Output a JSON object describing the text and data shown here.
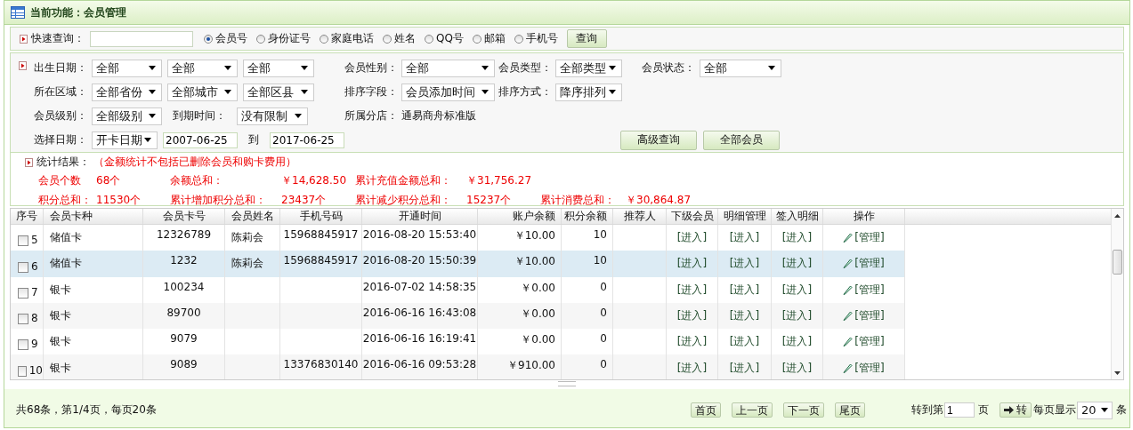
{
  "title": "当前功能：会员管理",
  "quick_search": {
    "label": "快速查询：",
    "options": [
      {
        "label": "会员号",
        "selected": true
      },
      {
        "label": "身份证号",
        "selected": false
      },
      {
        "label": "家庭电话",
        "selected": false
      },
      {
        "label": "姓名",
        "selected": false
      },
      {
        "label": "QQ号",
        "selected": false
      },
      {
        "label": "邮箱",
        "selected": false
      },
      {
        "label": "手机号",
        "selected": false
      }
    ],
    "button": "查询"
  },
  "filters": [
    [
      {
        "label": "出生日期：",
        "controls": [
          {
            "kind": "select",
            "value": "全部"
          },
          {
            "kind": "select",
            "value": "全部"
          },
          {
            "kind": "select",
            "value": "全部"
          }
        ]
      },
      {
        "label": "会员性别：",
        "controls": [
          {
            "kind": "select",
            "value": "全部"
          }
        ]
      },
      {
        "label": "会员类型：",
        "controls": [
          {
            "kind": "select",
            "value": "全部类型"
          }
        ]
      },
      {
        "label": "会员状态：",
        "controls": [
          {
            "kind": "select",
            "value": "全部"
          }
        ]
      }
    ],
    [
      {
        "label": "所在区域：",
        "controls": [
          {
            "kind": "select",
            "value": "全部省份"
          },
          {
            "kind": "select",
            "value": "全部城市"
          },
          {
            "kind": "select",
            "value": "全部区县"
          }
        ]
      },
      {
        "label": "排序字段：",
        "controls": [
          {
            "kind": "select",
            "value": "会员添加时间"
          }
        ]
      },
      {
        "label": "排序方式：",
        "controls": [
          {
            "kind": "select",
            "value": "降序排列"
          }
        ]
      }
    ],
    [
      {
        "label": "会员级别：",
        "controls": [
          {
            "kind": "select",
            "value": "全部级别"
          },
          {
            "kind": "label",
            "value": "到期时间："
          },
          {
            "kind": "select",
            "value": "没有限制"
          }
        ]
      },
      {
        "label": "所属分店：",
        "controls": [
          {
            "kind": "text",
            "value": "通易商舟标准版"
          }
        ]
      }
    ],
    [
      {
        "label": "选择日期：",
        "controls": [
          {
            "kind": "select",
            "value": "开卡日期"
          },
          {
            "kind": "date",
            "value": "2007-06-25"
          },
          {
            "kind": "label",
            "value": "到"
          },
          {
            "kind": "date",
            "value": "2017-06-25"
          }
        ]
      },
      {
        "controls": [
          {
            "kind": "button",
            "value": "高级查询"
          },
          {
            "kind": "button",
            "value": "全部会员"
          }
        ]
      }
    ]
  ],
  "stats": {
    "title": "统计结果：",
    "note": "（金额统计不包括已删除会员和购卡费用）",
    "rows": [
      [
        {
          "label": "会员个数",
          "value": "68个"
        },
        {
          "label": "余额总和：",
          "value": "￥14,628.50"
        },
        {
          "label": "累计充值金额总和：",
          "value": "￥31,756.27"
        }
      ],
      [
        {
          "label": "积分总和：",
          "value": "11530个"
        },
        {
          "label": "累计增加积分总和：",
          "value": "23437个"
        },
        {
          "label": "累计减少积分总和：",
          "value": "15237个"
        },
        {
          "label": "累计消费总和：",
          "value": "￥30,864.87"
        }
      ]
    ]
  },
  "table": {
    "columns": [
      "序号",
      "会员卡种",
      "会员卡号",
      "会员姓名",
      "手机号码",
      "开通时间",
      "账户余额",
      "积分余额",
      "推荐人",
      "下级会员",
      "明细管理",
      "签入明细",
      "操作"
    ],
    "rows": [
      {
        "selected": false,
        "checked": false,
        "seq": "5",
        "card_type": "储值卡",
        "card_no": "12326789",
        "name": "陈莉会",
        "phone": "15968845917",
        "opened": "2016-08-20 15:53:40",
        "balance": "￥10.00",
        "points": "10",
        "subordinate": "[进入]",
        "detail": "[进入]",
        "sign_in": "[进入]",
        "action": "[管理]"
      },
      {
        "selected": true,
        "checked": false,
        "seq": "6",
        "card_type": "储值卡",
        "card_no": "1232",
        "name": "陈莉会",
        "phone": "15968845917",
        "opened": "2016-08-20 15:50:39",
        "balance": "￥10.00",
        "points": "10",
        "subordinate": "[进入]",
        "detail": "[进入]",
        "sign_in": "[进入]",
        "action": "[管理]"
      },
      {
        "selected": false,
        "checked": false,
        "seq": "7",
        "card_type": "银卡",
        "card_no": "100234",
        "opened": "2016-07-02 14:58:35",
        "balance": "￥0.00",
        "points": "0",
        "subordinate": "[进入]",
        "detail": "[进入]",
        "sign_in": "[进入]",
        "action": "[管理]"
      },
      {
        "selected": false,
        "checked": false,
        "seq": "8",
        "card_type": "银卡",
        "card_no": "89700",
        "opened": "2016-06-16 16:43:08",
        "balance": "￥0.00",
        "points": "0",
        "subordinate": "[进入]",
        "detail": "[进入]",
        "sign_in": "[进入]",
        "action": "[管理]"
      },
      {
        "selected": false,
        "checked": false,
        "seq": "9",
        "card_type": "银卡",
        "card_no": "9079",
        "opened": "2016-06-16 16:19:41",
        "balance": "￥0.00",
        "points": "0",
        "subordinate": "[进入]",
        "detail": "[进入]",
        "sign_in": "[进入]",
        "action": "[管理]"
      },
      {
        "selected": false,
        "checked": false,
        "seq": "10",
        "card_type": "银卡",
        "card_no": "9089",
        "phone": "13376830140",
        "opened": "2016-06-16 09:53:28",
        "balance": "￥910.00",
        "points": "0",
        "subordinate": "[进入]",
        "detail": "[进入]",
        "sign_in": "[进入]",
        "action": "[管理]"
      }
    ]
  },
  "pager": {
    "summary": "共68条，第1/4页，每页20条",
    "buttons": [
      "首页",
      "上一页",
      "下一页",
      "尾页"
    ],
    "goto_label": "转到第",
    "goto_value": "1",
    "goto_unit": "页",
    "go_button": "转",
    "per_page_label": "每页显示",
    "per_page": "20",
    "per_page_unit": "条"
  }
}
